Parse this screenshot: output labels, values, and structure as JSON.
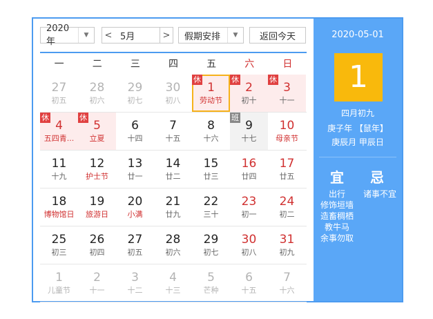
{
  "toolbar": {
    "year": "2020年",
    "prev_month": "<",
    "month": "5月",
    "next_month": ">",
    "holiday_select": "假期安排",
    "today_button": "返回今天"
  },
  "weekdays": [
    "一",
    "二",
    "三",
    "四",
    "五",
    "六",
    "日"
  ],
  "weeks": [
    [
      {
        "d": "27",
        "l": "初五",
        "out": true
      },
      {
        "d": "28",
        "l": "初六",
        "out": true
      },
      {
        "d": "29",
        "l": "初七",
        "out": true
      },
      {
        "d": "30",
        "l": "初八",
        "out": true
      },
      {
        "d": "1",
        "l": "劳动节",
        "badge": "休",
        "holiday": true,
        "red": true,
        "redsub": true,
        "selected": true
      },
      {
        "d": "2",
        "l": "初十",
        "badge": "休",
        "holiday": true,
        "red": true
      },
      {
        "d": "3",
        "l": "十一",
        "badge": "休",
        "holiday": true,
        "red": true
      }
    ],
    [
      {
        "d": "4",
        "l": "五四青...",
        "badge": "休",
        "holiday": true,
        "red": true,
        "redsub": true
      },
      {
        "d": "5",
        "l": "立夏",
        "badge": "休",
        "holiday": true,
        "red": true,
        "redsub": true
      },
      {
        "d": "6",
        "l": "十四"
      },
      {
        "d": "7",
        "l": "十五"
      },
      {
        "d": "8",
        "l": "十六"
      },
      {
        "d": "9",
        "l": "十七",
        "badge": "班",
        "workday": true
      },
      {
        "d": "10",
        "l": "母亲节",
        "red": true,
        "redsub": true
      }
    ],
    [
      {
        "d": "11",
        "l": "十九"
      },
      {
        "d": "12",
        "l": "护士节",
        "redsub": true
      },
      {
        "d": "13",
        "l": "廿一"
      },
      {
        "d": "14",
        "l": "廿二"
      },
      {
        "d": "15",
        "l": "廿三"
      },
      {
        "d": "16",
        "l": "廿四",
        "red": true
      },
      {
        "d": "17",
        "l": "廿五",
        "red": true
      }
    ],
    [
      {
        "d": "18",
        "l": "博物馆日",
        "redsub": true
      },
      {
        "d": "19",
        "l": "旅游日",
        "redsub": true
      },
      {
        "d": "20",
        "l": "小满",
        "redsub": true
      },
      {
        "d": "21",
        "l": "廿九"
      },
      {
        "d": "22",
        "l": "三十"
      },
      {
        "d": "23",
        "l": "初一",
        "red": true
      },
      {
        "d": "24",
        "l": "初二",
        "red": true
      }
    ],
    [
      {
        "d": "25",
        "l": "初三"
      },
      {
        "d": "26",
        "l": "初四"
      },
      {
        "d": "27",
        "l": "初五"
      },
      {
        "d": "28",
        "l": "初六"
      },
      {
        "d": "29",
        "l": "初七"
      },
      {
        "d": "30",
        "l": "初八",
        "red": true
      },
      {
        "d": "31",
        "l": "初九",
        "red": true
      }
    ],
    [
      {
        "d": "1",
        "l": "儿童节",
        "out": true
      },
      {
        "d": "2",
        "l": "十一",
        "out": true
      },
      {
        "d": "3",
        "l": "十二",
        "out": true
      },
      {
        "d": "4",
        "l": "十三",
        "out": true
      },
      {
        "d": "5",
        "l": "芒种",
        "out": true
      },
      {
        "d": "6",
        "l": "十五",
        "out": true
      },
      {
        "d": "7",
        "l": "十六",
        "out": true
      }
    ]
  ],
  "side": {
    "date": "2020-05-01",
    "day": "1",
    "lunar": "四月初九",
    "year_gz": "庚子年 【鼠年】",
    "month_day_gz": "庚辰月 甲辰日",
    "yi_title": "宜",
    "ji_title": "忌",
    "yi_items": [
      "出行",
      "修饰垣墙",
      "造畜稠栖",
      "教牛马",
      "余事勿取"
    ],
    "ji_items": [
      "诸事不宜"
    ]
  },
  "colors": {
    "border": "#4c9bf0",
    "side_bg": "#5aa7f7",
    "highlight": "#f9b90c",
    "holiday_bg": "#fdecec",
    "red": "#d03030"
  }
}
